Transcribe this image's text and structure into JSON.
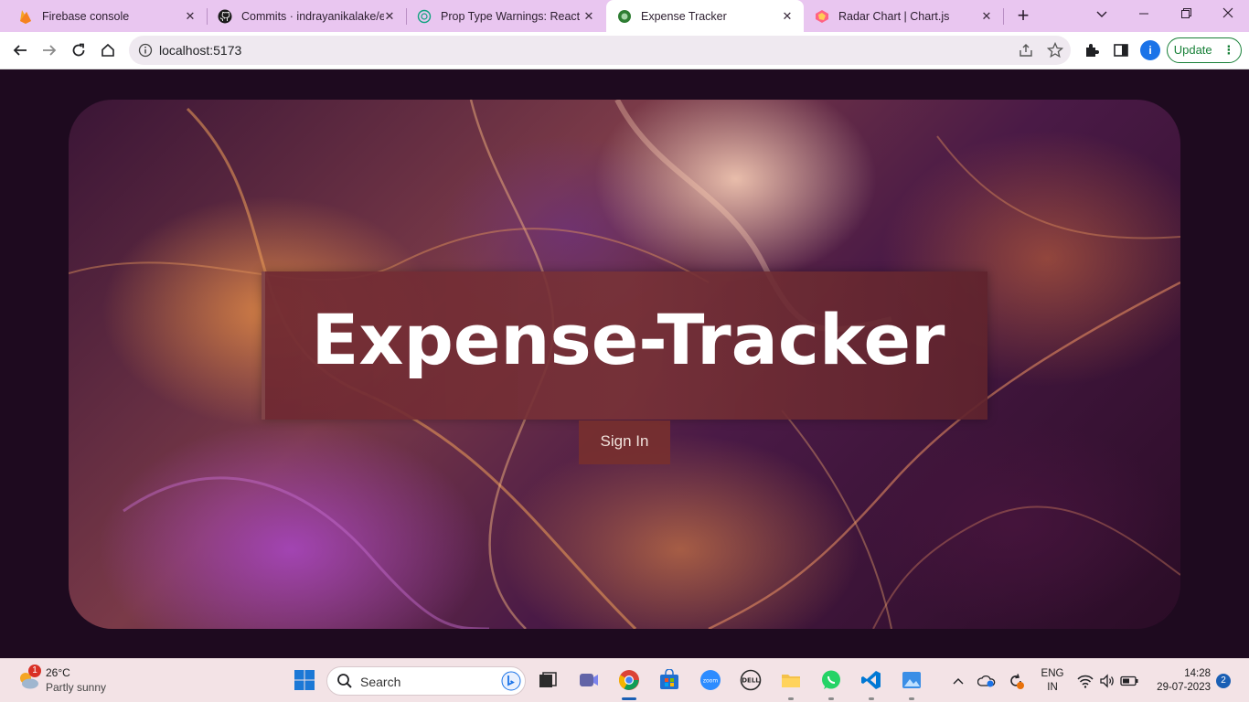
{
  "browser": {
    "tabs": [
      {
        "title": "Firebase console",
        "icon": "firebase-icon",
        "active": false
      },
      {
        "title": "Commits · indrayanikalake/ex",
        "icon": "github-icon",
        "active": false
      },
      {
        "title": "Prop Type Warnings: React",
        "icon": "chatgpt-icon",
        "active": false
      },
      {
        "title": "Expense Tracker",
        "icon": "app-favicon",
        "active": true
      },
      {
        "title": "Radar Chart | Chart.js",
        "icon": "chartjs-icon",
        "active": false
      }
    ],
    "url": "localhost:5173",
    "profile_initial": "i",
    "update_label": "Update"
  },
  "page": {
    "title": "Expense-Tracker",
    "signin_label": "Sign In"
  },
  "taskbar": {
    "weather": {
      "temp": "26°C",
      "desc": "Partly sunny",
      "badge": "1"
    },
    "search_placeholder": "Search",
    "lang_line1": "ENG",
    "lang_line2": "IN",
    "time": "14:28",
    "date": "29-07-2023",
    "notifications": "2"
  },
  "colors": {
    "tabstrip": "#e9c6f0",
    "page_bg": "#1e0a1f",
    "update_green": "#188038",
    "taskbar": "#f3e3e6"
  }
}
